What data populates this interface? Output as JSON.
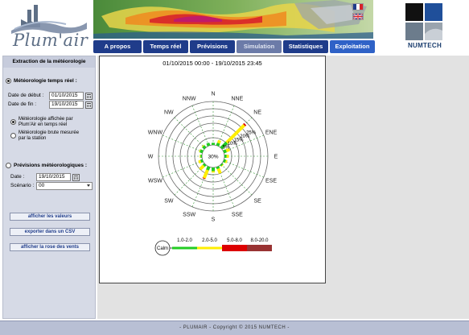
{
  "header": {
    "logo_text": "Plum'air",
    "numtech_text": "NUMTECH",
    "flags": [
      "flag-fr",
      "flag-uk"
    ]
  },
  "nav": {
    "items": [
      {
        "label": "A propos",
        "color": "#1f3c8a"
      },
      {
        "label": "Temps réel",
        "color": "#1f3c8a"
      },
      {
        "label": "Prévisions",
        "color": "#1f3c8a"
      },
      {
        "label": "Simulation",
        "color": "#6c7ba8"
      },
      {
        "label": "Statistiques",
        "color": "#1f3c8a"
      },
      {
        "label": "Exploitation",
        "color": "#2f62c7"
      }
    ]
  },
  "sidebar": {
    "title": "Extraction de la météorologie",
    "realtime_label": "Météorologie temps réel :",
    "start_label": "Date de début :",
    "start_value": "01/10/2015",
    "end_label": "Date de fin :",
    "end_value": "19/10/2015",
    "opt1_line1": "Météorologie affichée par",
    "opt1_line2": "Plum'Air en temps réel",
    "opt2_line1": "Météorologie brute mesurée",
    "opt2_line2": "par la station",
    "forecast_label": "Prévisions météorologiques :",
    "date_label": "Date :",
    "date_value": "19/10/2015",
    "scenario_label": "Scénario :",
    "scenario_value": "00",
    "btn_show": "afficher les valeurs",
    "btn_export": "exporter dans un CSV",
    "btn_rose": "afficher la rose des vents"
  },
  "chart_data": {
    "type": "windrose",
    "title": "01/10/2015 00:00 - 19/10/2015 23:45",
    "directions": [
      "N",
      "NNE",
      "NE",
      "ENE",
      "E",
      "ESE",
      "SE",
      "SSE",
      "S",
      "SSW",
      "SW",
      "WSW",
      "W",
      "WNW",
      "NW",
      "NNW"
    ],
    "ring_labels": [
      "5%",
      "10%",
      "15%",
      "20%",
      "25%",
      "30%"
    ],
    "ring_values": [
      5,
      10,
      15,
      20,
      25,
      30
    ],
    "rmax": 30,
    "calm_center_label": "30%",
    "bins": [
      {
        "label": "1.0-2.0",
        "color": "#22cc22"
      },
      {
        "label": "2.0-5.0",
        "color": "#ffee00"
      },
      {
        "label": "5.0-8.0",
        "color": "#dd0000"
      },
      {
        "label": "8.0-20.0",
        "color": "#993333"
      }
    ],
    "calm_label": "Calm",
    "series": [
      {
        "name": "1.0-2.0",
        "values": [
          1.5,
          2,
          5.5,
          2,
          1.5,
          1.5,
          1,
          1.5,
          2.5,
          2.5,
          1.5,
          1.5,
          1,
          2,
          2,
          2
        ]
      },
      {
        "name": "2.0-5.0",
        "values": [
          0,
          2,
          17,
          2.5,
          1.5,
          1,
          0.5,
          3.5,
          1,
          6,
          3.5,
          1.5,
          0.5,
          0.5,
          0.5,
          0
        ]
      },
      {
        "name": "5.0-8.0",
        "values": [
          0,
          0,
          1,
          0,
          0,
          0,
          0,
          0,
          0,
          0.5,
          0,
          0,
          0,
          0,
          0,
          0
        ]
      },
      {
        "name": "8.0-20.0",
        "values": [
          0,
          0,
          0,
          0,
          0,
          0,
          0,
          0,
          0,
          0,
          0,
          0,
          0,
          0,
          0,
          0
        ]
      }
    ]
  },
  "footer": {
    "text": "- PLUMAIR - Copyright © 2015 NUMTECH -"
  },
  "colors": {
    "nav_blue": "#1f3c8a",
    "sidebar_bg": "#d6dae6",
    "footer_bg": "#b8bfd4"
  }
}
